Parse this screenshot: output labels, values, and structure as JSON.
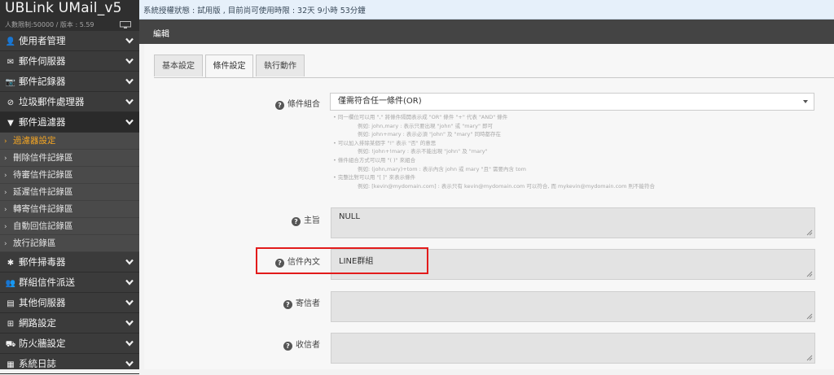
{
  "app": {
    "title": "UBLink UMail_v5",
    "subtitle": "人數限制:50000 / 版本 : 5.59"
  },
  "sidebar": {
    "items": [
      {
        "label": "使用者管理",
        "icon": "user-icon",
        "glyph": "👤"
      },
      {
        "label": "郵件伺服器",
        "icon": "envelope-icon",
        "glyph": "✉"
      },
      {
        "label": "郵件記錄器",
        "icon": "camera-icon",
        "glyph": "📷"
      },
      {
        "label": "垃圾郵件處理器",
        "icon": "ban-icon",
        "glyph": "⊘"
      },
      {
        "label": "郵件過濾器",
        "icon": "filter-icon",
        "glyph": "▼"
      }
    ],
    "sub_items": [
      {
        "label": "過濾器設定"
      },
      {
        "label": "刪除信件記錄區"
      },
      {
        "label": "待審信件記錄區"
      },
      {
        "label": "延遲信件記錄區"
      },
      {
        "label": "轉寄信件記錄區"
      },
      {
        "label": "自動回信記錄區"
      },
      {
        "label": "放行記錄區"
      }
    ],
    "items_after": [
      {
        "label": "郵件掃毒器",
        "icon": "bug-icon",
        "glyph": "✱"
      },
      {
        "label": "群組信件派送",
        "icon": "users-icon",
        "glyph": "👥"
      },
      {
        "label": "其他伺服器",
        "icon": "server-icon",
        "glyph": "▤"
      },
      {
        "label": "網路設定",
        "icon": "sitemap-icon",
        "glyph": "⊞"
      },
      {
        "label": "防火牆設定",
        "icon": "truck-icon",
        "glyph": "⛟"
      },
      {
        "label": "系統日誌",
        "icon": "log-icon",
        "glyph": "▦"
      }
    ]
  },
  "status": {
    "text": "系統授權狀態 : 試用版 , 目前尚可使用時限 : 32天 9小時 53分鐘"
  },
  "edit": {
    "title": "編輯"
  },
  "tabs": [
    {
      "label": "基本設定"
    },
    {
      "label": "條件設定"
    },
    {
      "label": "執行動作"
    }
  ],
  "form": {
    "condition_label": "條件組合",
    "condition_value": "僅需符合任一條件(OR)",
    "hints": [
      "• 同一欄位可以用 \",\" 將條件隔開表示成 \"OR\" 條件 \"+\" 代表 \"AND\" 條件",
      "例如: john,mary : 表示只要出現 \"john\" 或 \"mary\" 即可",
      "例如: john+mary : 表示必須 \"john\" 及 \"mary\" 同時都存在",
      "• 可以加入排除某個字 \"!\" 表示 \"否\" 的意思",
      "例如: !john+!mary : 表示不能出現 \"john\" 及 \"mary\"",
      "• 條件組合方式可以用 \"( )\" 來組合",
      "例如: (john,mary)+tom : 表示內含 john 或 mary \"且\" 需要內含 tom",
      "• 完整比對可以用 \"[ ]\" 來表示條件",
      "例如: [kevin@mydomain.com] : 表示只有 kevin@mydomain.com 可以符合, 而 mykevin@mydomain.com 則不能符合"
    ],
    "subject_label": "主旨",
    "subject_value": "NULL",
    "body_label": "信件內文",
    "body_value": "LINE群組",
    "sender_label": "寄信者",
    "sender_value": "",
    "recipient_label": "收信者",
    "recipient_value": ""
  },
  "colors": {
    "sidebar_bg": "#3b3b3b",
    "accent": "#f5a623",
    "highlight": "#e21b1b"
  }
}
